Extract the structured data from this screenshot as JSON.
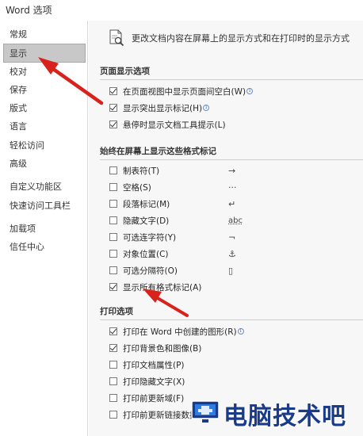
{
  "window": {
    "title": "Word 选项"
  },
  "sidebar": {
    "items": [
      {
        "label": "常规"
      },
      {
        "label": "显示",
        "selected": true
      },
      {
        "label": "校对"
      },
      {
        "label": "保存"
      },
      {
        "label": "版式"
      },
      {
        "label": "语言"
      },
      {
        "label": "轻松访问"
      },
      {
        "label": "高级"
      },
      {
        "label": "自定义功能区"
      },
      {
        "label": "快速访问工具栏"
      },
      {
        "label": "加载项"
      },
      {
        "label": "信任中心"
      }
    ]
  },
  "main": {
    "header_text": "更改文档内容在屏幕上的显示方式和在打印时的显示方式",
    "page_display": {
      "title": "页面显示选项",
      "options": [
        {
          "label": "在页面视图中显示页面间空白(W)",
          "checked": true,
          "info": true
        },
        {
          "label": "显示突出显示标记(H)",
          "checked": true,
          "info": true
        },
        {
          "label": "悬停时显示文档工具提示(L)",
          "checked": true,
          "info": false
        }
      ]
    },
    "format_marks": {
      "title": "始终在屏幕上显示这些格式标记",
      "options": [
        {
          "label": "制表符(T)",
          "checked": false,
          "symbol": "→"
        },
        {
          "label": "空格(S)",
          "checked": false,
          "symbol": "···"
        },
        {
          "label": "段落标记(M)",
          "checked": false,
          "symbol": "↵"
        },
        {
          "label": "隐藏文字(D)",
          "checked": false,
          "symbol": "abc"
        },
        {
          "label": "可选连字符(Y)",
          "checked": false,
          "symbol": "¬"
        },
        {
          "label": "对象位置(C)",
          "checked": false,
          "symbol": "⚓"
        },
        {
          "label": "可选分隔符(O)",
          "checked": false,
          "symbol": "▯"
        },
        {
          "label": "显示所有格式标记(A)",
          "checked": true,
          "symbol": ""
        }
      ]
    },
    "print": {
      "title": "打印选项",
      "options": [
        {
          "label": "打印在 Word 中创建的图形(R)",
          "checked": true,
          "info": true
        },
        {
          "label": "打印背景色和图像(B)",
          "checked": true,
          "info": false
        },
        {
          "label": "打印文档属性(P)",
          "checked": false,
          "info": false
        },
        {
          "label": "打印隐藏文字(X)",
          "checked": false,
          "info": false
        },
        {
          "label": "打印前更新域(F)",
          "checked": false,
          "info": false
        },
        {
          "label": "打印前更新链接数据(K)",
          "checked": false,
          "info": false
        }
      ]
    }
  },
  "watermark": {
    "text": "电脑技术吧"
  },
  "colors": {
    "arrow": "#d9221c",
    "selected_bg": "#c8c8c8",
    "panel_bg": "#f7f7f7"
  }
}
